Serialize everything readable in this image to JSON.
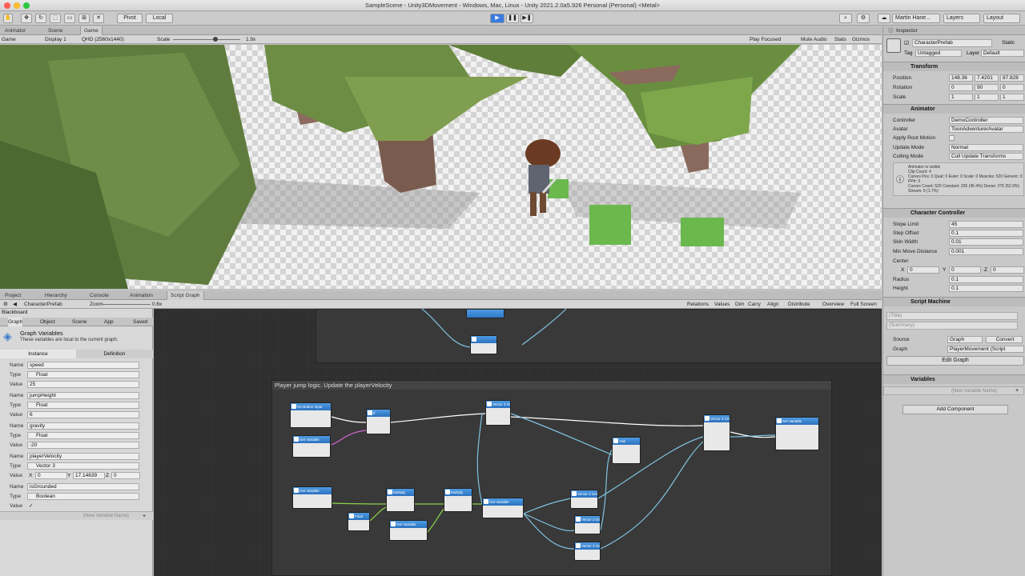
{
  "window": {
    "title": "SampleScene - Unity3DMovement - Windows, Mac, Linux - Unity 2021.2.0a5.926 Personal (Personal) <Metal>"
  },
  "toolbar": {
    "pivot": "Pivot",
    "local": "Local",
    "account": "Martin Hane...",
    "layers": "Layers",
    "layout": "Layout"
  },
  "top_tabs": [
    "Animator",
    "Scene",
    "Game"
  ],
  "game_bar": {
    "view": "Game",
    "display": "Display 1",
    "resolution": "QHD (2560x1440)",
    "scale_label": "Scale",
    "scale_value": "1.9x",
    "play_focused": "Play Focused",
    "mute": "Mute Audio",
    "stats": "Stats",
    "gizmos": "Gizmos"
  },
  "bottom_tabs": [
    "Project",
    "Hierarchy",
    "Console",
    "Animation",
    "Script Graph"
  ],
  "graph_bar": {
    "asset": "CharacterPrefab",
    "zoom_label": "Zoom",
    "zoom_value": "0.6x",
    "buttons": [
      "Relations",
      "Values",
      "Dim",
      "Carry",
      "Align",
      "Distribute",
      "Overview",
      "Full Screen"
    ]
  },
  "blackboard": {
    "title": "Blackboard",
    "tabs": [
      "Graph",
      "Object",
      "Scene",
      "App",
      "Saved"
    ],
    "heading": "Graph Variables",
    "description": "These variables are local to the current graph.",
    "subtabs": [
      "Instance",
      "Definition"
    ],
    "labels": {
      "name": "Name",
      "type": "Type",
      "value": "Value"
    },
    "variables": [
      {
        "name": "speed",
        "type": "Float",
        "value": "25"
      },
      {
        "name": "jumpHeight",
        "type": "Float",
        "value": "6"
      },
      {
        "name": "gravity",
        "type": "Float",
        "value": "-20"
      },
      {
        "name": "playerVelocity",
        "type": "Vector 3",
        "x": "0",
        "y": "17.14639",
        "z": "0"
      },
      {
        "name": "isGrounded",
        "type": "Boolean",
        "value": "✓"
      }
    ],
    "new_var_placeholder": "(New Variable Name)"
  },
  "graph": {
    "group_title": "Player jump logic. Update the playerVelocity",
    "nodes": [
      "On Button Input",
      "Get Variable",
      "If",
      "Vector 3 Get Y",
      "Add",
      "Vector 3 Create",
      "Set Variable",
      "Get Variable",
      "Multiply",
      "Multiply",
      "Get Variable",
      "Vector 3 Get X",
      "Vector 3 Get Y",
      "Vector 3 Get Z",
      "Float",
      "Get Variable",
      "Vector 3 Set 2"
    ]
  },
  "inspector": {
    "tab": "Inspector",
    "object_name": "CharacterPrefab",
    "static_label": "Static",
    "tag_label": "Tag",
    "tag": "Untagged",
    "layer_label": "Layer",
    "layer": "Default",
    "transform": {
      "title": "Transform",
      "position_label": "Position",
      "position": [
        "148.36",
        "7.4201",
        "87.828"
      ],
      "rotation_label": "Rotation",
      "rotation": [
        "0",
        "90",
        "0"
      ],
      "scale_label": "Scale",
      "scale": [
        "1",
        "1",
        "1"
      ]
    },
    "animator": {
      "title": "Animator",
      "controller_label": "Controller",
      "controller": "DemoController",
      "avatar_label": "Avatar",
      "avatar": "ToonAdventurerAvatar",
      "root_motion_label": "Apply Root Motion",
      "update_mode_label": "Update Mode",
      "update_mode": "Normal",
      "culling_label": "Culling Mode",
      "culling": "Cull Update Transforms",
      "info": [
        "Animator is visible",
        "Clip Count: 4",
        "Curves Pos: 0 Quat: 0 Euler: 0 Scale: 0 Muscles: 520 Generic: 0 PPtr: 0",
        "Curves Count: 520 Constant: 236 (45.4%) Dense: 275 (52.9%) Stream: 9 (1.7%)"
      ]
    },
    "character_controller": {
      "title": "Character Controller",
      "fields": [
        {
          "label": "Slope Limit",
          "value": "45"
        },
        {
          "label": "Step Offset",
          "value": "0.1"
        },
        {
          "label": "Skin Width",
          "value": "0.01"
        },
        {
          "label": "Min Move Distance",
          "value": "0.001"
        }
      ],
      "center_label": "Center",
      "center": [
        "0",
        "0",
        "0"
      ],
      "radius_label": "Radius",
      "radius": "0.1",
      "height_label": "Height",
      "height": "0.1"
    },
    "script_machine": {
      "title": "Script Machine",
      "title_placeholder": "(Title)",
      "summary_placeholder": "(Summary)",
      "source_label": "Source",
      "source": "Graph",
      "convert": "Convert",
      "graph_label": "Graph",
      "graph": "PlayerMovement (Script",
      "edit": "Edit Graph"
    },
    "variables": {
      "title": "Variables",
      "placeholder": "(New Variable Name)"
    },
    "add_component": "Add Component"
  }
}
